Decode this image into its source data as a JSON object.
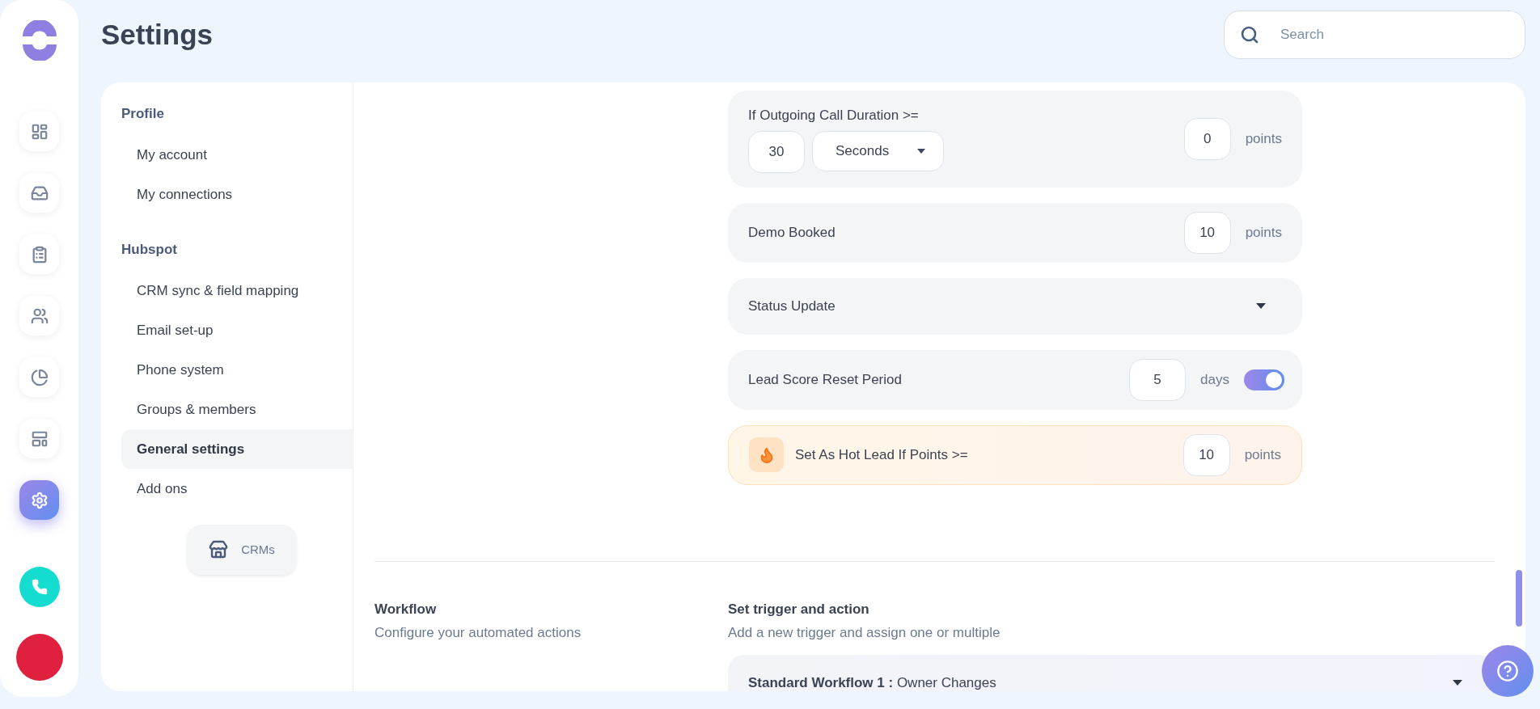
{
  "page_title": "Settings",
  "search": {
    "placeholder": "Search"
  },
  "rail": {
    "items": [
      {
        "kind": "dashboard",
        "selected": false
      },
      {
        "kind": "inbox",
        "selected": false
      },
      {
        "kind": "clipboard",
        "selected": false
      },
      {
        "kind": "team",
        "selected": false
      },
      {
        "kind": "pie",
        "selected": false
      },
      {
        "kind": "layout",
        "selected": false
      },
      {
        "kind": "settings",
        "selected": true
      }
    ]
  },
  "nav": {
    "sections": [
      {
        "title": "Profile",
        "items": [
          {
            "label": "My account",
            "selected": false
          },
          {
            "label": "My connections",
            "selected": false
          }
        ]
      },
      {
        "title": "Hubspot",
        "items": [
          {
            "label": "CRM sync & field mapping",
            "selected": false
          },
          {
            "label": "Email set-up",
            "selected": false
          },
          {
            "label": "Phone system",
            "selected": false
          },
          {
            "label": "Groups & members",
            "selected": false
          },
          {
            "label": "General settings",
            "selected": true
          },
          {
            "label": "Add ons",
            "selected": false
          }
        ]
      }
    ],
    "crm_button": "CRMs"
  },
  "scoring_rows": [
    {
      "kind": "duration",
      "label": "If Outgoing Call Duration >=",
      "amount": "30",
      "unit": "Seconds",
      "points": "0",
      "points_label": "points"
    },
    {
      "kind": "points",
      "label": "Demo Booked",
      "points": "10",
      "points_label": "points"
    },
    {
      "kind": "dropdown",
      "label": "Status Update"
    },
    {
      "kind": "reset",
      "label": "Lead Score Reset Period",
      "value": "5",
      "unit": "days",
      "on": true
    },
    {
      "kind": "hot",
      "label": "Set As Hot Lead If Points >=",
      "points": "10",
      "points_label": "points"
    }
  ],
  "workflow": {
    "title": "Workflow",
    "description": "Configure your automated actions",
    "trigger_title": "Set trigger and action",
    "trigger_description": "Add a new trigger and assign one or multiple",
    "items": [
      {
        "name": "Standard Workflow 1 :",
        "trigger": "Owner Changes"
      }
    ]
  }
}
